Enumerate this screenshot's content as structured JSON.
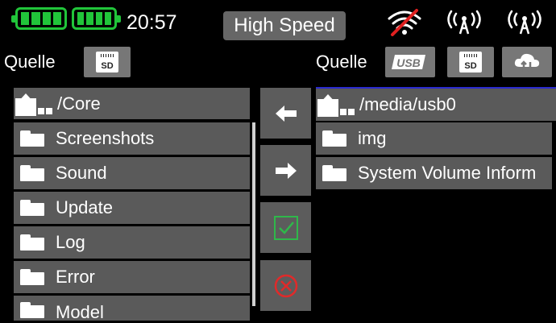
{
  "status": {
    "time": "20:57",
    "mode": "High Speed",
    "battery_count": 2,
    "battery_color": "#21c53a",
    "icons": [
      "wifi-off-icon",
      "antenna-icon",
      "antenna-icon"
    ]
  },
  "left_panel": {
    "source_label": "Quelle",
    "source_icon": "SD",
    "path": "/Core",
    "items": [
      "Screenshots",
      "Sound",
      "Update",
      "Log",
      "Error",
      "Model"
    ]
  },
  "right_panel": {
    "source_label": "Quelle",
    "sources": [
      "USB",
      "SD",
      "cloud"
    ],
    "path": "/media/usb0",
    "items": [
      "img",
      "System Volume Inform"
    ]
  },
  "actions": {
    "copy_left": "arrow-left-icon",
    "copy_right": "arrow-right-icon",
    "confirm": "check-icon",
    "cancel": "cancel-icon"
  }
}
